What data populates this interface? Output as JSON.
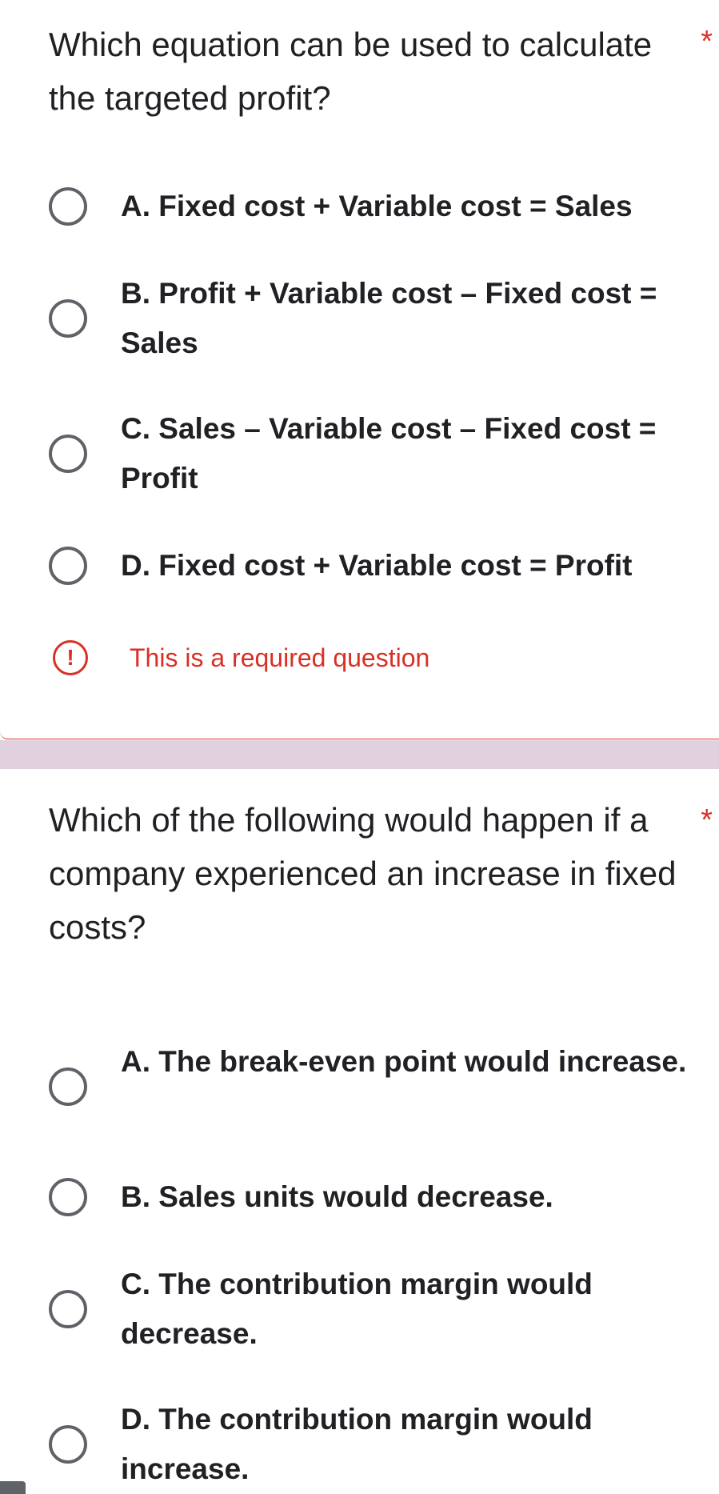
{
  "questions": [
    {
      "title": "Which equation can be used to calculate the targeted profit?",
      "required_marker": "*",
      "options": [
        "A. Fixed cost + Variable cost = Sales",
        "B. Profit + Variable cost – Fixed cost = Sales",
        "C. Sales – Variable cost – Fixed cost = Profit",
        "D. Fixed cost + Variable cost = Profit"
      ],
      "error_icon": "!",
      "error_text": "This is a required question"
    },
    {
      "title": "Which of the following would happen if a company experienced an increase in fixed costs?",
      "required_marker": "*",
      "options": [
        "A. The break-even point would increase.",
        "B. Sales units would decrease.",
        "C. The contribution margin would decrease.",
        "D. The contribution margin would increase."
      ]
    }
  ],
  "colors": {
    "error": "#d93025",
    "radio_border": "#5f6368",
    "section_gap": "#e1d0dd",
    "text": "#202124"
  },
  "icons": {
    "radio": "radio-circle-icon",
    "error": "exclamation-circle-icon"
  }
}
